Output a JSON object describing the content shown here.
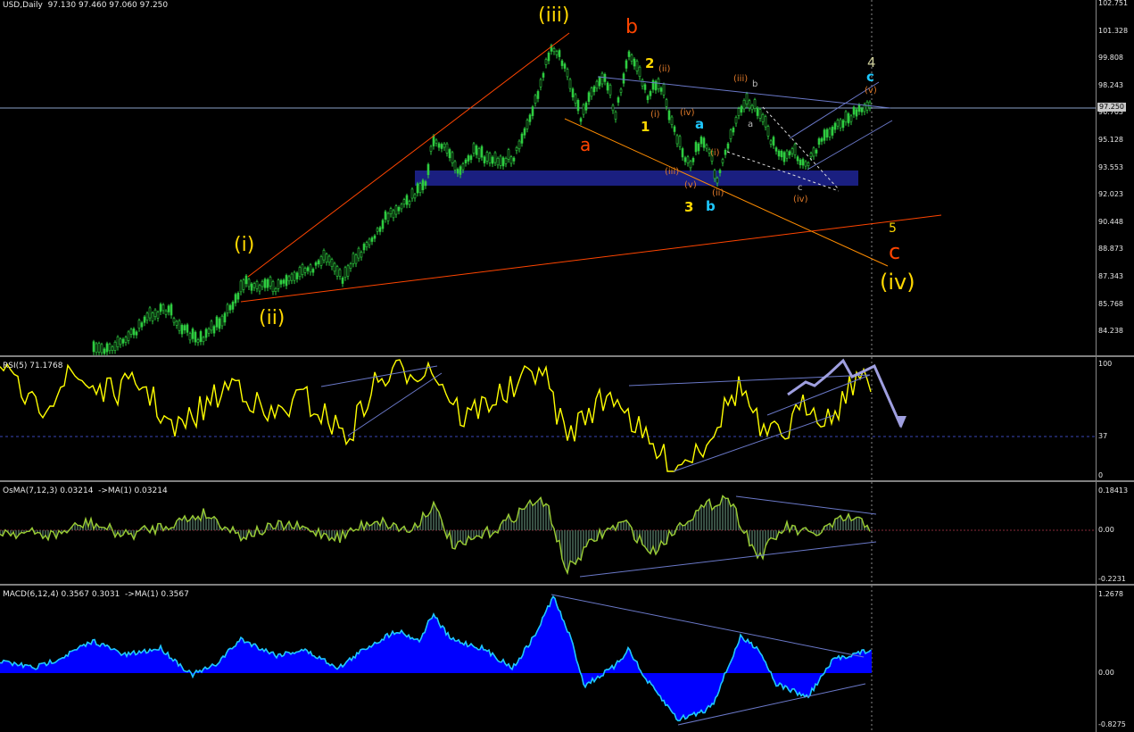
{
  "main_title": "USD,Daily  97.130 97.460 97.060 97.250",
  "price_ticks": [
    "102.751",
    "101.328",
    "99.808",
    "98.243",
    "96.703",
    "95.128",
    "93.553",
    "92.023",
    "90.448",
    "88.873",
    "87.343",
    "85.768",
    "84.238"
  ],
  "current_price": "97.250",
  "wave_labels": {
    "iii_top": "(iii)",
    "b_top": "b",
    "two": "2",
    "ii_small": "(ii)",
    "iii_small": "(iii)",
    "b_small": "b",
    "a_red": "a",
    "one": "1",
    "i_small": "(i)",
    "iv_small": "(iv)",
    "a_blue": "a",
    "a_small": "a",
    "i_small2": "(i)",
    "iii_small2": "(iii)",
    "v_small": "(v)",
    "three": "3",
    "b_blue": "b",
    "ii_small2": "(ii)",
    "c_small": "c",
    "iv_small2": "(iv)",
    "four": "4",
    "c_blue": "c",
    "v_small2": "(v)",
    "five": "5",
    "c_red": "c",
    "iv_big": "(iv)",
    "i_big": "(i)",
    "ii_big": "(ii)"
  },
  "rsi": {
    "title": "RSI(5) 71.1768",
    "ticks": [
      "100",
      "37",
      "0"
    ]
  },
  "osma": {
    "title": "OsMA(7,12,3) 0.03214  ->MA(1) 0.03214",
    "ticks": [
      "0.18413",
      "0.00",
      "-0.2231"
    ]
  },
  "macd": {
    "title": "MACD(6,12,4) 0.3567 0.3031  ->MA(1) 0.3567",
    "ticks": [
      "1.2678",
      "0.00",
      "-0.8275"
    ]
  }
}
